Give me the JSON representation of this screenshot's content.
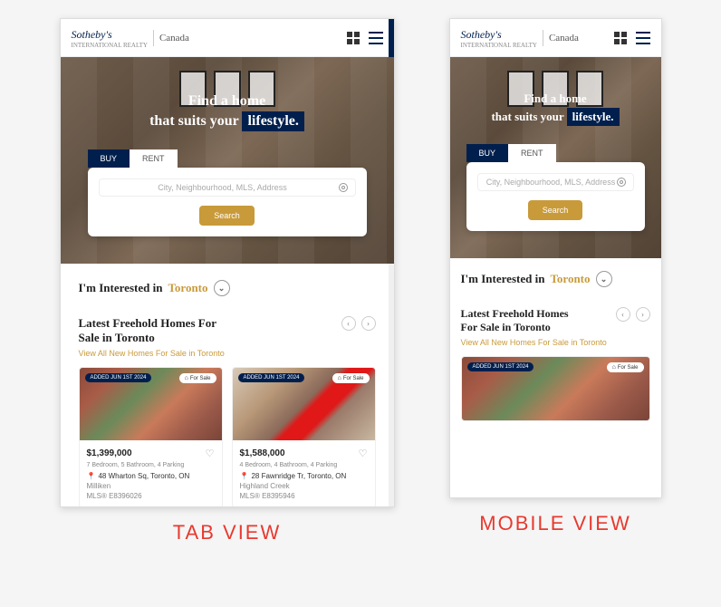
{
  "brand": {
    "name": "Sotheby's",
    "sub": "INTERNATIONAL REALTY",
    "country": "Canada"
  },
  "hero": {
    "line1": "Find a home",
    "line2_pre": "that suits your",
    "line2_hl": "lifestyle."
  },
  "tabs": {
    "buy": "BUY",
    "rent": "RENT"
  },
  "search": {
    "placeholder": "City, Neighbourhood, MLS, Address",
    "button": "Search"
  },
  "interest": {
    "prefix": "I'm Interested in",
    "city": "Toronto"
  },
  "section": {
    "title": "Latest Freehold Homes For Sale in Toronto",
    "viewAll": "View All New Homes For Sale in Toronto"
  },
  "cards": [
    {
      "dateBadge": "ADDED JUN 1ST 2024",
      "saleBadge": "For Sale",
      "price": "$1,399,000",
      "specs": "7 Bedroom, 5 Bathroom, 4 Parking",
      "address": "48 Wharton Sq, Toronto, ON",
      "neighborhood": "Milliken",
      "mls": "MLS® E8396026"
    },
    {
      "dateBadge": "ADDED JUN 1ST 2024",
      "saleBadge": "For Sale",
      "price": "$1,588,000",
      "specs": "4 Bedroom, 4 Bathroom, 4 Parking",
      "address": "28 Fawnridge Tr, Toronto, ON",
      "neighborhood": "Highland Creek",
      "mls": "MLS® E8395946"
    }
  ],
  "labels": {
    "tabView": "TAB VIEW",
    "mobileView": "MOBILE VIEW"
  }
}
